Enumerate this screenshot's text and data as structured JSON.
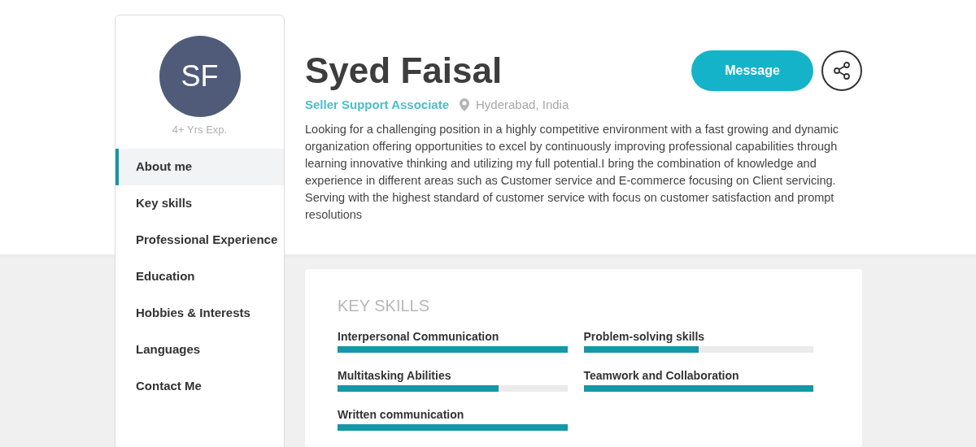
{
  "profile": {
    "initials": "SF",
    "experience": "4+ Yrs Exp.",
    "name": "Syed Faisal",
    "title": "Seller Support Associate",
    "location": "Hyderabad, India",
    "about": "Looking for a challenging position in a highly competitive environment with a fast growing and dynamic organization offering opportunities to excel by continuously improving professional capabilities through learning innovative thinking and utilizing my full potential.I bring the combination of knowledge and experience in different areas such as Customer service and E-commerce focusing on Client servicing. Serving with the highest standard of customer service with focus on customer satisfaction and prompt resolutions"
  },
  "actions": {
    "message_button": "Message"
  },
  "sidebar": {
    "items": [
      {
        "label": "About me",
        "selected": true
      },
      {
        "label": "Key skills",
        "selected": false
      },
      {
        "label": "Professional Experience",
        "selected": false
      },
      {
        "label": "Education",
        "selected": false
      },
      {
        "label": "Hobbies & Interests",
        "selected": false
      },
      {
        "label": "Languages",
        "selected": false
      },
      {
        "label": "Contact Me",
        "selected": false
      }
    ]
  },
  "key_skills": {
    "heading": "KEY SKILLS",
    "skills": [
      {
        "name": "Interpersonal Communication",
        "level": 1.0
      },
      {
        "name": "Problem-solving skills",
        "level": 0.5
      },
      {
        "name": "Multitasking Abilities",
        "level": 0.7
      },
      {
        "name": "Teamwork and Collaboration",
        "level": 1.0
      },
      {
        "name": "Written communication",
        "level": 1.0
      }
    ]
  }
}
